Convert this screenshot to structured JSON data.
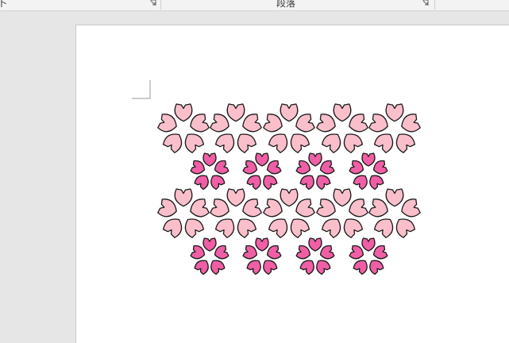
{
  "ribbon": {
    "font_group_label": "卜",
    "paragraph_group_label": "段落"
  },
  "colors": {
    "large_flower_fill": "#fbbfcc",
    "small_flower_fill": "#f05fa5",
    "flower_outline": "#1a1a1a",
    "canvas_bg": "#e6e6e6",
    "page_bg": "#ffffff"
  },
  "flowers": {
    "rows": [
      {
        "size": "large",
        "count": 5
      },
      {
        "size": "small",
        "count": 4
      },
      {
        "size": "large",
        "count": 5
      },
      {
        "size": "small",
        "count": 4
      }
    ]
  }
}
